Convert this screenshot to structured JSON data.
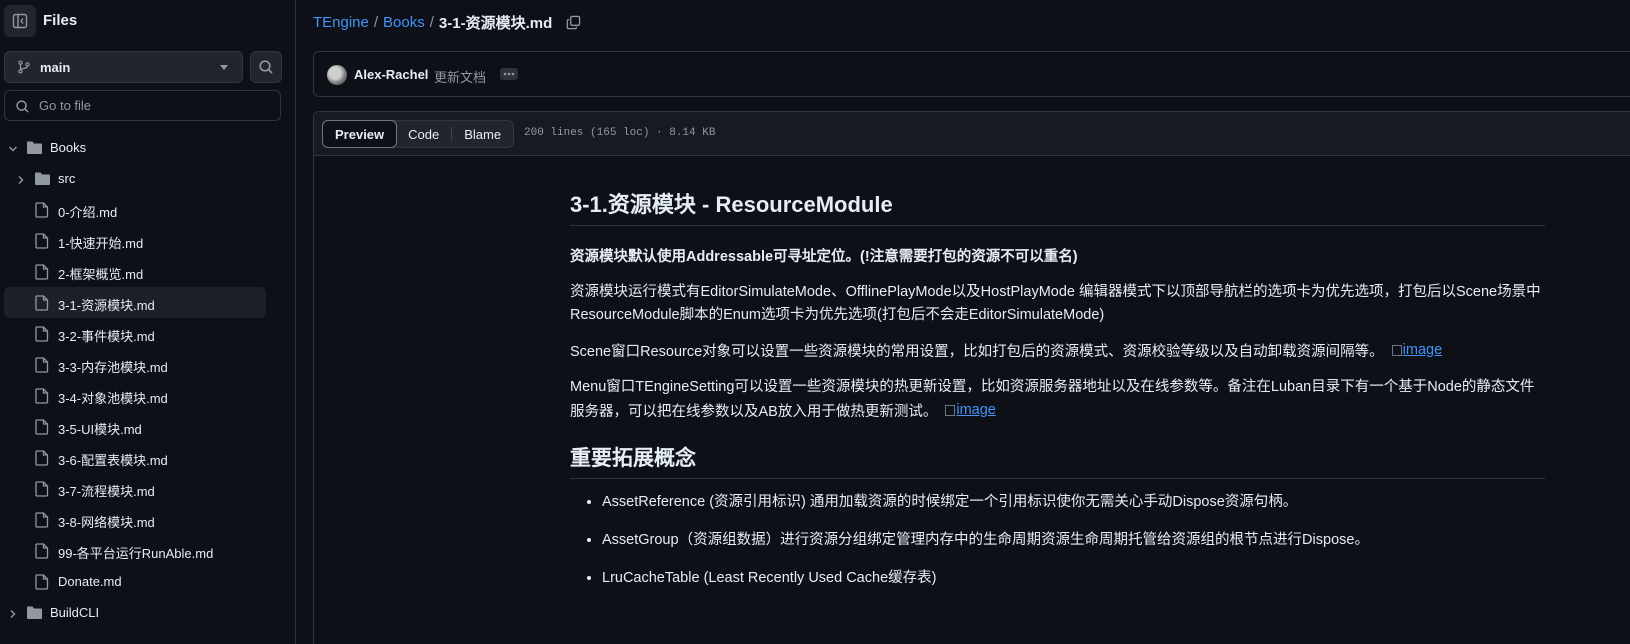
{
  "sidebar": {
    "title": "Files",
    "branch": "main",
    "goto_placeholder": "Go to file",
    "tree": [
      {
        "name": "Books",
        "type": "folder",
        "open": true
      },
      {
        "name": "src",
        "type": "folder",
        "open": false
      },
      {
        "name": "0-介绍.md",
        "type": "file"
      },
      {
        "name": "1-快速开始.md",
        "type": "file"
      },
      {
        "name": "2-框架概览.md",
        "type": "file"
      },
      {
        "name": "3-1-资源模块.md",
        "type": "file",
        "selected": true
      },
      {
        "name": "3-2-事件模块.md",
        "type": "file"
      },
      {
        "name": "3-3-内存池模块.md",
        "type": "file"
      },
      {
        "name": "3-4-对象池模块.md",
        "type": "file"
      },
      {
        "name": "3-5-UI模块.md",
        "type": "file"
      },
      {
        "name": "3-6-配置表模块.md",
        "type": "file"
      },
      {
        "name": "3-7-流程模块.md",
        "type": "file"
      },
      {
        "name": "3-8-网络模块.md",
        "type": "file"
      },
      {
        "name": "99-各平台运行RunAble.md",
        "type": "file"
      },
      {
        "name": "Donate.md",
        "type": "file"
      },
      {
        "name": "BuildCLI",
        "type": "folder",
        "open": false
      }
    ]
  },
  "breadcrumb": {
    "repo": "TEngine",
    "folder": "Books",
    "file": "3-1-资源模块.md",
    "separator": "/"
  },
  "commit": {
    "author": "Alex-Rachel",
    "message": "更新文档"
  },
  "file_view": {
    "tabs": [
      "Preview",
      "Code",
      "Blame"
    ],
    "active_tab": "Preview",
    "meta": "200 lines (165 loc) · 8.14 KB"
  },
  "markdown": {
    "h1": "3-1.资源模块 - ResourceModule",
    "p_bold": "资源模块默认使用Addressable可寻址定位。(!注意需要打包的资源不可以重名)",
    "p1": "资源模块运行模式有EditorSimulateMode、OfflinePlayMode以及HostPlayMode 编辑器模式下以顶部导航栏的选项卡为优先选项，打包后以Scene场景中ResourceModule脚本的Enum选项卡为优先选项(打包后不会走EditorSimulateMode)",
    "p2": "Scene窗口Resource对象可以设置一些资源模块的常用设置，比如打包后的资源模式、资源校验等级以及自动卸载资源间隔等。",
    "p3": "Menu窗口TEngineSetting可以设置一些资源模块的热更新设置，比如资源服务器地址以及在线参数等。备注在Luban目录下有一个基于Node的静态文件服务器，可以把在线参数以及AB放入用于做热更新测试。",
    "image_alt": "image",
    "h2": "重要拓展概念",
    "list": [
      "AssetReference (资源引用标识) 通用加载资源的时候绑定一个引用标识使你无需关心手动Dispose资源句柄。",
      "AssetGroup（资源组数据）进行资源分组绑定管理内存中的生命周期资源生命周期托管给资源组的根节点进行Dispose。",
      "LruCacheTable (Least Recently Used Cache缓存表)"
    ]
  },
  "colors": {
    "background": "#0d1117",
    "border": "#30363d",
    "link": "#4493f8",
    "muted": "#9198a1",
    "text": "#e6edf3"
  }
}
